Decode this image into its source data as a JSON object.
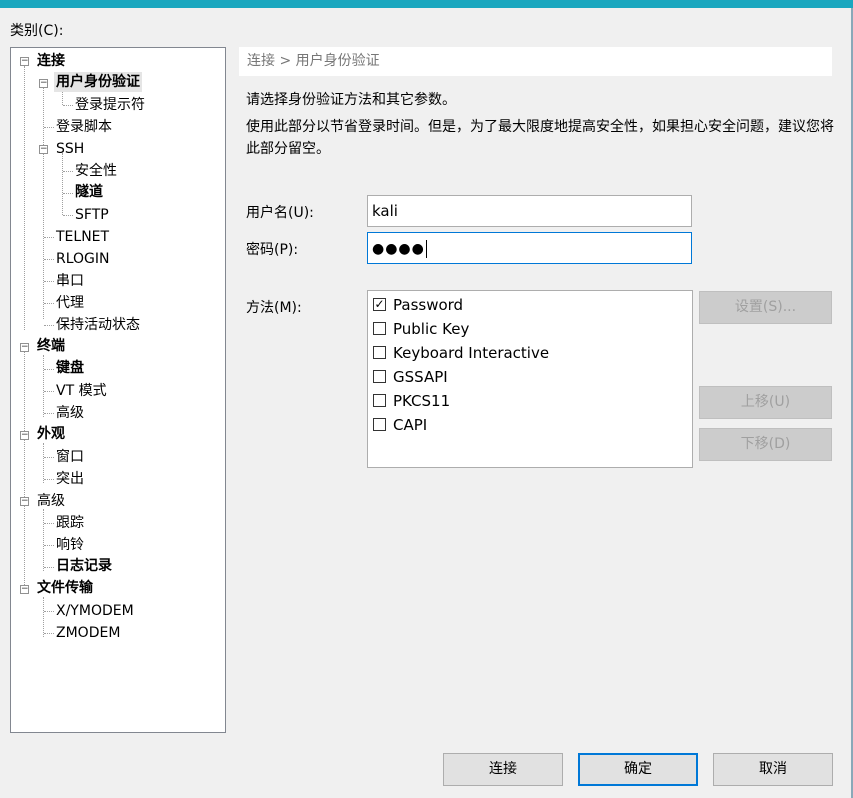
{
  "category_label": "类别(C):",
  "tree": {
    "items": [
      {
        "label": "连接"
      },
      {
        "label": "用户身份验证"
      },
      {
        "label": "登录提示符"
      },
      {
        "label": "登录脚本"
      },
      {
        "label": "SSH"
      },
      {
        "label": "安全性"
      },
      {
        "label": "隧道"
      },
      {
        "label": "SFTP"
      },
      {
        "label": "TELNET"
      },
      {
        "label": "RLOGIN"
      },
      {
        "label": "串口"
      },
      {
        "label": "代理"
      },
      {
        "label": "保持活动状态"
      },
      {
        "label": "终端"
      },
      {
        "label": "键盘"
      },
      {
        "label": "VT 模式"
      },
      {
        "label": "高级"
      },
      {
        "label": "外观"
      },
      {
        "label": "窗口"
      },
      {
        "label": "突出"
      },
      {
        "label": "高级"
      },
      {
        "label": "跟踪"
      },
      {
        "label": "响铃"
      },
      {
        "label": "日志记录"
      },
      {
        "label": "文件传输"
      },
      {
        "label": "X/YMODEM"
      },
      {
        "label": "ZMODEM"
      }
    ]
  },
  "panel": {
    "breadcrumb": "连接 > 用户身份验证",
    "desc_line1": "请选择身份验证方法和其它参数。",
    "desc_line2": "使用此部分以节省登录时间。但是，为了最大限度地提高安全性，如果担心安全问题，建议您将此部分留空。",
    "username_label": "用户名(U):",
    "username_value": "kali",
    "password_label": "密码(P):",
    "password_mask": "●●●●",
    "method_label": "方法(M):",
    "methods": [
      {
        "label": "Password",
        "checked": true
      },
      {
        "label": "Public Key",
        "checked": false
      },
      {
        "label": "Keyboard Interactive",
        "checked": false
      },
      {
        "label": "GSSAPI",
        "checked": false
      },
      {
        "label": "PKCS11",
        "checked": false
      },
      {
        "label": "CAPI",
        "checked": false
      }
    ],
    "settings_button": "设置(S)...",
    "move_up_button": "上移(U)",
    "move_down_button": "下移(D)"
  },
  "footer": {
    "connect_button": "连接",
    "ok_button": "确定",
    "cancel_button": "取消"
  },
  "colors": {
    "title_accent": "#1aa7bf",
    "focus_border": "#0078d7"
  }
}
